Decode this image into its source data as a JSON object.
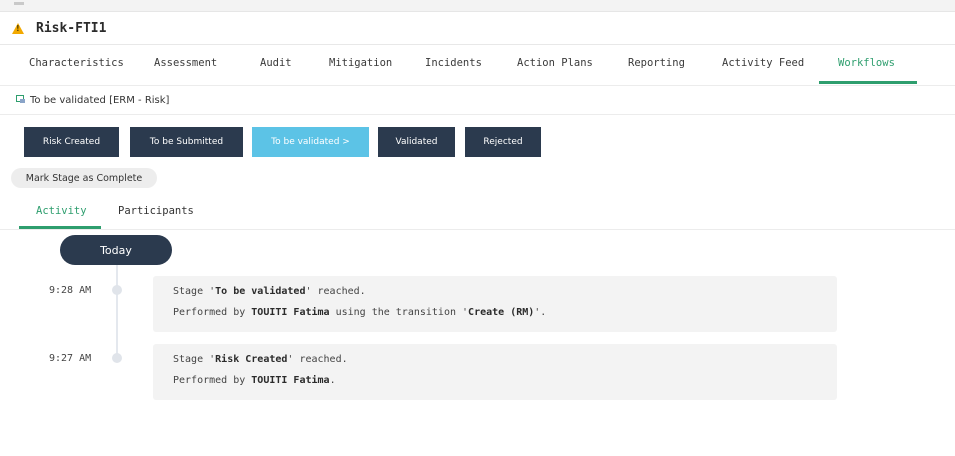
{
  "record": {
    "title": "Risk-FTI1"
  },
  "tabs": [
    {
      "label": "Characteristics"
    },
    {
      "label": "Assessment"
    },
    {
      "label": "Audit"
    },
    {
      "label": "Mitigation"
    },
    {
      "label": "Incidents"
    },
    {
      "label": "Action Plans"
    },
    {
      "label": "Reporting"
    },
    {
      "label": "Activity Feed"
    },
    {
      "label": "Workflows",
      "active": true
    }
  ],
  "stage": {
    "label": "To be validated [ERM - Risk]"
  },
  "pipeline": [
    {
      "label": "Risk Created"
    },
    {
      "label": "To be Submitted"
    },
    {
      "label": "To be validated >",
      "current": true
    },
    {
      "label": "Validated"
    },
    {
      "label": "Rejected"
    }
  ],
  "mark_stage_label": "Mark Stage as Complete",
  "subtabs": [
    {
      "label": "Activity",
      "active": true
    },
    {
      "label": "Participants"
    }
  ],
  "timeline": {
    "group_label": "Today",
    "entries": [
      {
        "time": "9:28 AM",
        "l1_pre": "Stage '",
        "l1_bold": "To be validated",
        "l1_post": "' reached.",
        "l2_pre": "Performed by ",
        "l2_bold": "TOUITI Fatima",
        "l2_mid": " using the transition '",
        "l2_bold2": "Create (RM)",
        "l2_post": "'."
      },
      {
        "time": "9:27 AM",
        "l1_pre": "Stage '",
        "l1_bold": "Risk Created",
        "l1_post": "' reached.",
        "l2_pre": "Performed by ",
        "l2_bold": "TOUITI Fatima",
        "l2_post": "."
      }
    ]
  },
  "colors": {
    "accent": "#2e9e6e",
    "dark_button": "#2b3a4e",
    "current_stage": "#5cc3e6",
    "warning": "#f2a900",
    "card_bg": "#f3f3f3"
  },
  "icons": {
    "header": "warning-icon",
    "stage": "workflow-stage-icon"
  }
}
